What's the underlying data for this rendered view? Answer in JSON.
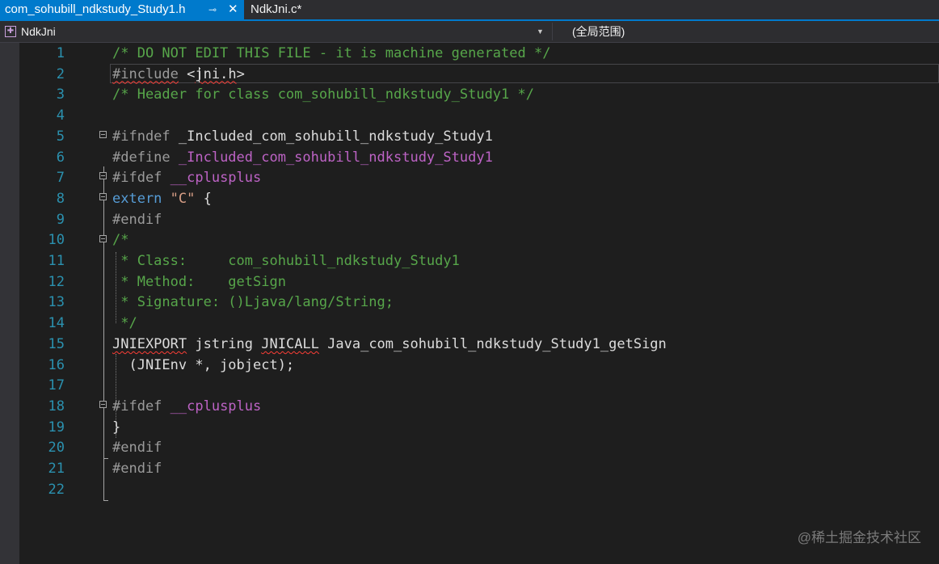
{
  "tabs": [
    {
      "label": "com_sohubill_ndkstudy_Study1.h",
      "active": true
    },
    {
      "label": "NdkJni.c*",
      "active": false
    }
  ],
  "tab_icons": {
    "pin": "⊸",
    "close": "✕"
  },
  "navbar": {
    "project": "NdkJni",
    "scope": "(全局范围)"
  },
  "editor": {
    "lines": [
      {
        "n": "1",
        "tokens": [
          {
            "t": "/* DO NOT EDIT THIS FILE - it is machine generated */",
            "c": "comment"
          }
        ]
      },
      {
        "n": "2",
        "tokens": [
          {
            "t": "#include",
            "c": "pre",
            "sq": true
          },
          {
            "t": " <",
            "c": "plain"
          },
          {
            "t": "jni.h",
            "c": "plain",
            "sq": true
          },
          {
            "t": ">",
            "c": "plain"
          }
        ]
      },
      {
        "n": "3",
        "tokens": [
          {
            "t": "/* Header for class com_sohubill_ndkstudy_Study1 */",
            "c": "comment"
          }
        ]
      },
      {
        "n": "4",
        "tokens": []
      },
      {
        "n": "5",
        "tokens": [
          {
            "t": "#ifndef ",
            "c": "pre"
          },
          {
            "t": "_Included_com_sohubill_ndkstudy_Study1",
            "c": "plain"
          }
        ]
      },
      {
        "n": "6",
        "tokens": [
          {
            "t": "#define ",
            "c": "pre"
          },
          {
            "t": "_Included_com_sohubill_ndkstudy_Study1",
            "c": "macro"
          }
        ]
      },
      {
        "n": "7",
        "tokens": [
          {
            "t": "#ifdef ",
            "c": "pre"
          },
          {
            "t": "__cplusplus",
            "c": "macro"
          }
        ]
      },
      {
        "n": "8",
        "tokens": [
          {
            "t": "extern ",
            "c": "kw"
          },
          {
            "t": "\"C\"",
            "c": "str"
          },
          {
            "t": " {",
            "c": "plain"
          }
        ]
      },
      {
        "n": "9",
        "tokens": [
          {
            "t": "#endif",
            "c": "pre"
          }
        ]
      },
      {
        "n": "10",
        "tokens": [
          {
            "t": "/*",
            "c": "comment"
          }
        ]
      },
      {
        "n": "11",
        "tokens": [
          {
            "t": " * Class:     com_sohubill_ndkstudy_Study1",
            "c": "comment"
          }
        ]
      },
      {
        "n": "12",
        "tokens": [
          {
            "t": " * Method:    getSign",
            "c": "comment"
          }
        ]
      },
      {
        "n": "13",
        "tokens": [
          {
            "t": " * Signature: ()Ljava/lang/String;",
            "c": "comment"
          }
        ]
      },
      {
        "n": "14",
        "tokens": [
          {
            "t": " */",
            "c": "comment"
          }
        ]
      },
      {
        "n": "15",
        "tokens": [
          {
            "t": "JNIEXPORT",
            "c": "plain",
            "sq": true
          },
          {
            "t": " jstring ",
            "c": "plain"
          },
          {
            "t": "JNICALL",
            "c": "plain",
            "sq": true
          },
          {
            "t": " Java_com_sohubill_ndkstudy_Study1_getSign",
            "c": "plain"
          }
        ]
      },
      {
        "n": "16",
        "tokens": [
          {
            "t": "  (JNIEnv *, jobject);",
            "c": "plain"
          }
        ]
      },
      {
        "n": "17",
        "tokens": []
      },
      {
        "n": "18",
        "tokens": [
          {
            "t": "#ifdef ",
            "c": "pre"
          },
          {
            "t": "__cplusplus",
            "c": "macro"
          }
        ]
      },
      {
        "n": "19",
        "tokens": [
          {
            "t": "}",
            "c": "plain"
          }
        ]
      },
      {
        "n": "20",
        "tokens": [
          {
            "t": "#endif",
            "c": "pre"
          }
        ]
      },
      {
        "n": "21",
        "tokens": [
          {
            "t": "#endif",
            "c": "pre"
          }
        ]
      },
      {
        "n": "22",
        "tokens": []
      }
    ]
  },
  "watermark": "@稀土掘金技术社区",
  "colors": {
    "accent": "#007acc",
    "comment": "#57a64a",
    "preprocessor": "#9b9b9b",
    "macro": "#bd63c5",
    "keyword": "#569cd6",
    "string": "#d69d85",
    "line_number": "#2b91af"
  }
}
